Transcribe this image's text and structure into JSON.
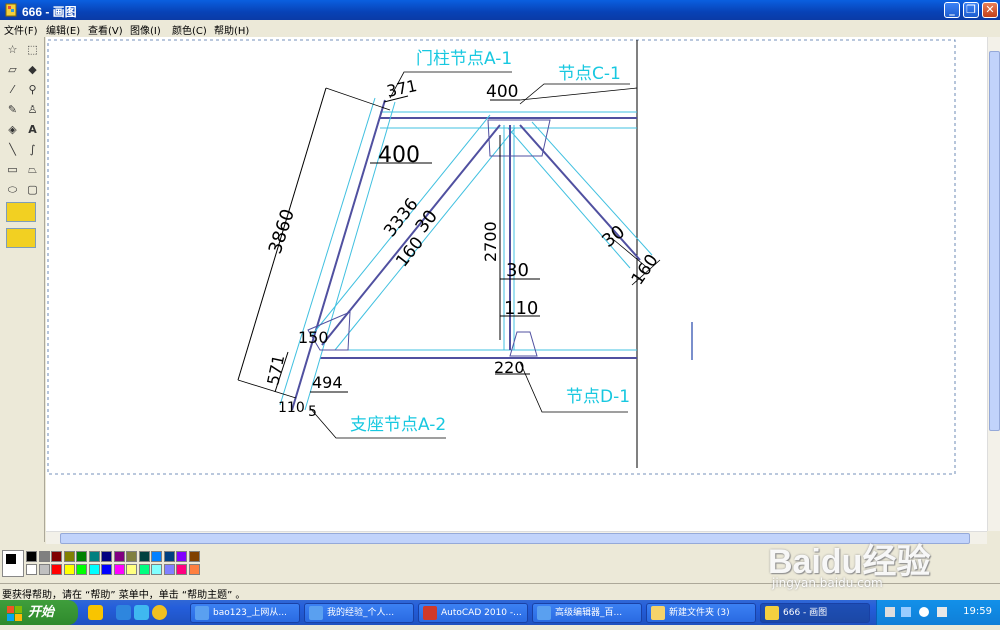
{
  "window": {
    "title": "666 - 画图"
  },
  "menu": [
    "文件(F)",
    "编辑(E)",
    "查看(V)",
    "图像(I)",
    "颜色(C)",
    "帮助(H)"
  ],
  "drawing": {
    "labels": {
      "node_a1": "门柱节点A-1",
      "node_c1": "节点C-1",
      "node_d1": "节点D-1",
      "node_a2": "支座节点A-2"
    },
    "dims": {
      "d371": "371",
      "d400_top": "400",
      "d400_left": "400",
      "d3860": "3860",
      "d3336": "3336",
      "d30_left": "30",
      "d160_left": "160",
      "d2700": "2700",
      "d30_mid": "30",
      "d110": "110",
      "d30_right": "30",
      "d160_right": "160",
      "d150": "150",
      "d571": "571",
      "d494": "494",
      "d220": "220",
      "d110_bottom": "110",
      "d5": "5"
    }
  },
  "palette_colors": [
    "#000000",
    "#808080",
    "#800000",
    "#808000",
    "#008000",
    "#008080",
    "#000080",
    "#800080",
    "#808040",
    "#004040",
    "#0080ff",
    "#004080",
    "#8000ff",
    "#804000",
    "#ffffff",
    "#c0c0c0",
    "#ff0000",
    "#ffff00",
    "#00ff00",
    "#00ffff",
    "#0000ff",
    "#ff00ff",
    "#ffff80",
    "#00ff80",
    "#80ffff",
    "#8080ff",
    "#ff0080",
    "#ff8040"
  ],
  "status": "要获得帮助，请在 “帮助” 菜单中，单击 “帮助主题” 。",
  "taskbar": {
    "start": "开始",
    "tasks": [
      "bao123_上网从...",
      "我的经验_个人...",
      "AutoCAD 2010 -...",
      "高级编辑器_百...",
      "新建文件夹 (3)",
      "666 - 画图"
    ],
    "clock": "19:59"
  },
  "watermark": {
    "brand": "Baidu经验",
    "url": "jingyan.baidu.com"
  }
}
